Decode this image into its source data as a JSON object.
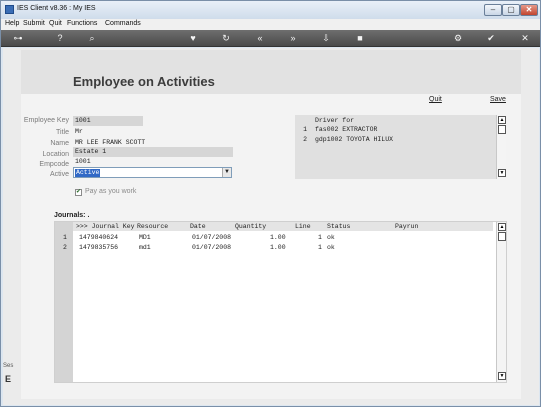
{
  "window": {
    "title": "IES Client v8.36 : My IES",
    "controls": {
      "minimize": "–",
      "maximize": "▢",
      "close": "✕"
    }
  },
  "menu": [
    "Help",
    "Submit",
    "Quit",
    "Functions",
    "Commands"
  ],
  "toolbar": {
    "icons": [
      "key-icon",
      "help-icon",
      "search-icon",
      "heart-icon",
      "refresh-icon",
      "rewind-icon",
      "fast-forward-icon",
      "download-icon",
      "stop-icon",
      "settings-icon",
      "check-icon",
      "close-icon"
    ],
    "glyphs": [
      "⊶",
      "?",
      "⌕",
      "♥",
      "↻",
      "«",
      "»",
      "⇩",
      "■",
      "⚙",
      "✔",
      "✕"
    ]
  },
  "page": {
    "title": "Employee on Activities",
    "actions": {
      "quit": "Quit",
      "save": "Save"
    }
  },
  "form": {
    "employee_key": {
      "label": "Employee Key",
      "value": "1001"
    },
    "title": {
      "label": "Title",
      "value": "Mr"
    },
    "name": {
      "label": "Name",
      "value": "MR LEE FRANK SCOTT"
    },
    "location": {
      "label": "Location",
      "value": "Estate 1"
    },
    "empcode": {
      "label": "Empcode",
      "value": "1001"
    },
    "active": {
      "label": "Active",
      "value": "Active"
    },
    "pay_as_you_work": {
      "label": "Pay as you work",
      "checked": true,
      "mark": "✔"
    }
  },
  "driver_for": {
    "header": "Driver for",
    "rows": [
      {
        "num": "1",
        "value": "fas002 EXTRACTOR"
      },
      {
        "num": "2",
        "value": "gdp1002 TOYOTA HILUX"
      }
    ]
  },
  "journals": {
    "title": "Journals: .",
    "columns": [
      ">>> Journal Key",
      "Resource",
      "Date",
      "Quantity",
      "Line",
      "Status",
      "Payrun"
    ],
    "rows": [
      {
        "num": "1",
        "journal_key": "1479840624",
        "resource": "MD1",
        "date": "01/07/2008",
        "quantity": "1.00",
        "line": "1",
        "status": "ok",
        "payrun": ""
      },
      {
        "num": "2",
        "journal_key": "1479835756",
        "resource": "md1",
        "date": "01/07/2008",
        "quantity": "1.00",
        "line": "1",
        "status": "ok",
        "payrun": ""
      }
    ]
  },
  "sidebar_fragments": {
    "top": "Ses",
    "bottom": "E"
  },
  "scroll_glyphs": {
    "up": "▲",
    "down": "▼"
  }
}
